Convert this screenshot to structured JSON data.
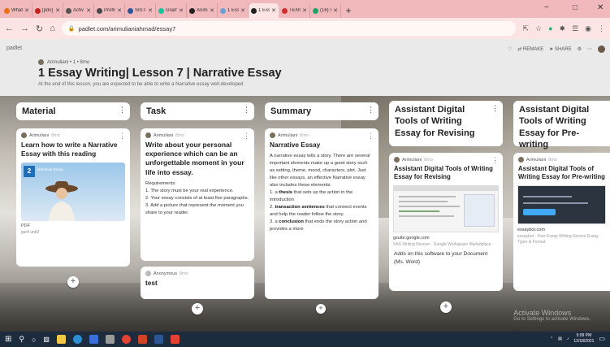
{
  "browser": {
    "tabs": [
      {
        "label": "What:",
        "color": "#e8711a",
        "active": false
      },
      {
        "label": "[pdx]",
        "color": "#c5221f",
        "active": false
      },
      {
        "label": "Activ",
        "color": "#555555",
        "active": false
      },
      {
        "label": "Profil",
        "color": "#4a4a4a",
        "active": false
      },
      {
        "label": "SISTE",
        "color": "#2b5797",
        "active": false
      },
      {
        "label": "Gram",
        "color": "#15c39a",
        "active": false
      },
      {
        "label": "Anim",
        "color": "#222222",
        "active": false
      },
      {
        "label": "1 Essa",
        "color": "#6aa0d8",
        "active": false
      },
      {
        "label": "1 Essa",
        "color": "#222222",
        "active": true
      },
      {
        "label": "TENS",
        "color": "#d32f2f",
        "active": false
      },
      {
        "label": "(16) W",
        "color": "#1fa463",
        "active": false
      }
    ],
    "url": "padlet.com/arimulianiahmad/essay7"
  },
  "padlet": {
    "logo": "padlet",
    "author": "Arimuliani • 1 • 8mo",
    "title": "1 Essay Writing| Lesson 7 | Narrative Essay",
    "subtitle": "At the end of this lesson, you are expected to be able to write a Narrative essay well-developed",
    "actions": {
      "remake": "REMAKE",
      "share": "SHARE"
    }
  },
  "columns": [
    {
      "title": "Material"
    },
    {
      "title": "Task"
    },
    {
      "title": "Summary"
    },
    {
      "title": "Assistant Digital Tools of Writing Essay for Revising"
    },
    {
      "title": "Assistant Digital Tools of Writing Essay for Pre-writing"
    }
  ],
  "cards": {
    "material": {
      "author": "Arimuliani",
      "time": "8mo",
      "title": "Learn how to write a Narrative Essay with this reading",
      "thumb_badge": "2",
      "thumb_text": "Narrative Essay",
      "file_type": "PDF",
      "file_name": "gar4 unit2"
    },
    "task": {
      "author": "Arimuliani",
      "time": "8mo",
      "title": "Write about your personal experience which can be an unforgettable moment in your life into essay.",
      "req_label": "Requirements:",
      "req_1": "1. The story must be your real experience.",
      "req_2": "2. Your essay consists of at least five paragraphs.",
      "req_3": "3. Add a picture that represent the moment you share to your reader."
    },
    "task2": {
      "author": "Anonymous",
      "time": "8mo",
      "title": "test"
    },
    "summary": {
      "author": "Arimuliani",
      "time": "8mo",
      "title": "Narrative Essay",
      "intro": "A narrative essay tells a story. There are several important elements make up a good story such as setting, theme, mood, characters, plot. Just like other essays, an effective Narrative essay also includes these elements:",
      "p1_num": "1. a ",
      "p1_bold": "thesis",
      "p1_rest": " that sets up the action in the introduction",
      "p2_num": "2. ",
      "p2_bold": "transaction sentences",
      "p2_rest": " that connect events and help the reader follow the story.",
      "p3_num": "3. a ",
      "p3_bold": "conclusion",
      "p3_rest": " that ends the story action and provides a more"
    },
    "revising": {
      "author": "Arimuliani",
      "time": "8mo",
      "title": "Assistant Digital Tools of Writing Essay for Revising",
      "domain": "gsuite.google.com",
      "meta": "SAS Writing Reviser - Google Workspace Marketplace",
      "desc": "Adds on this software to your Document (Ms. Word)"
    },
    "prewriting": {
      "author": "Arimuliani",
      "time": "8mo",
      "title": "Assistant Digital Tools of Writing Essay for Pre-writing",
      "domain": "essaybot.com",
      "meta": "essaybot - Free Essay Writing Service Essay Typer & Format"
    }
  },
  "watermark": {
    "title": "Activate Windows",
    "sub": "Go to Settings to activate Windows."
  },
  "taskbar": {
    "time": "5:09 PM",
    "date": "12/18/2021"
  }
}
